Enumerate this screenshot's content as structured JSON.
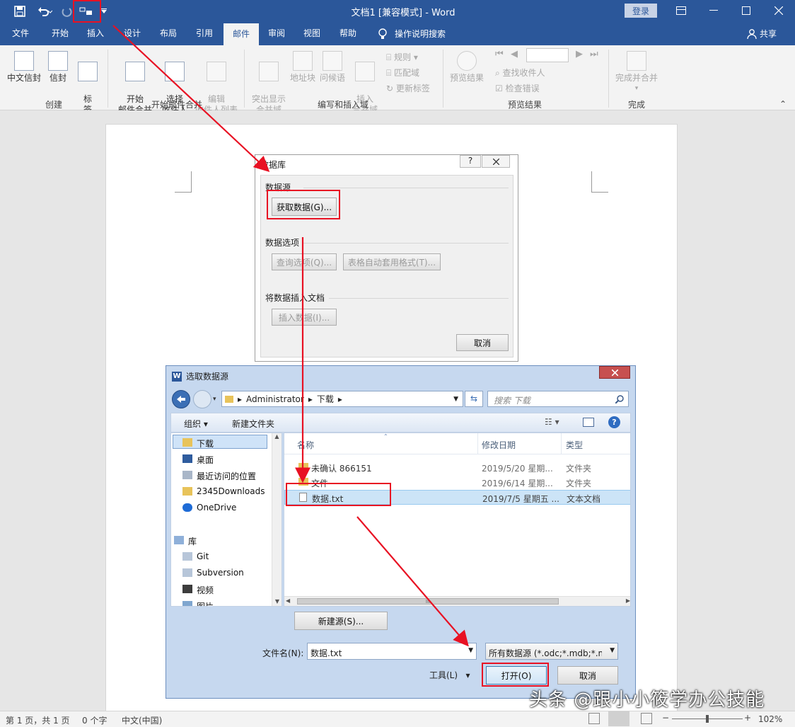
{
  "window": {
    "title": "文档1 [兼容模式] - Word",
    "login_label": "登录",
    "colors": {
      "brand": "#2b579a",
      "annotation": "#e81123"
    }
  },
  "quick_access": {
    "save_icon": "save-icon",
    "undo_icon": "undo-icon",
    "redo_icon": "redo-icon",
    "mailmerge_icon": "database-icon",
    "customize_icon": "dropdown-icon"
  },
  "tabs": [
    {
      "label": "文件"
    },
    {
      "label": "开始"
    },
    {
      "label": "插入"
    },
    {
      "label": "设计"
    },
    {
      "label": "布局"
    },
    {
      "label": "引用"
    },
    {
      "label": "邮件",
      "active": true
    },
    {
      "label": "审阅"
    },
    {
      "label": "视图"
    },
    {
      "label": "帮助"
    }
  ],
  "tell_me": "操作说明搜索",
  "share": "共享",
  "ribbon": {
    "create": {
      "envelope": "中文信封",
      "envelopes": "信封",
      "labels": "标\n签",
      "group": "创建"
    },
    "start": {
      "start_merge": "开始\n邮件合并",
      "select_recipients": "选择\n收件人",
      "edit_list": "编辑\n收件人列表",
      "group": "开始邮件合并"
    },
    "write": {
      "highlight": "突出显示\n合并域",
      "address_block": "地址块",
      "greeting": "问候语",
      "insert_field": "插入\n合并域",
      "rules": "规则",
      "match_fields": "匹配域",
      "update_labels": "更新标签",
      "group": "编写和插入域"
    },
    "preview": {
      "preview_results": "预览结果",
      "find_recipient": "查找收件人",
      "check_errors": "检查错误",
      "group": "预览结果"
    },
    "finish": {
      "finish_merge": "完成并合并",
      "group": "完成"
    }
  },
  "db_dialog": {
    "title": "数据库",
    "help": "?",
    "section_source": "数据源",
    "get_data": "获取数据(G)...",
    "section_options": "数据选项",
    "query_options": "查询选项(Q)...",
    "table_autoformat": "表格自动套用格式(T)...",
    "section_insert": "将数据插入文档",
    "insert_data": "插入数据(I)...",
    "cancel": "取消"
  },
  "file_dialog": {
    "title": "选取数据源",
    "breadcrumb": [
      "Administrator",
      "下载"
    ],
    "search_placeholder": "搜索 下载",
    "organize": "组织",
    "new_folder": "新建文件夹",
    "nav": [
      {
        "label": "下载",
        "icon": "downloads-folder-icon",
        "selected": true
      },
      {
        "label": "桌面",
        "icon": "desktop-icon"
      },
      {
        "label": "最近访问的位置",
        "icon": "recent-places-icon"
      },
      {
        "label": "2345Downloads",
        "icon": "folder-icon"
      },
      {
        "label": "OneDrive",
        "icon": "onedrive-icon"
      },
      {
        "label": "库",
        "icon": "library-icon"
      },
      {
        "label": "Git",
        "icon": "library-folder-icon"
      },
      {
        "label": "Subversion",
        "icon": "library-folder-icon"
      },
      {
        "label": "视频",
        "icon": "video-icon"
      },
      {
        "label": "图片",
        "icon": "pictures-icon"
      }
    ],
    "columns": [
      "名称",
      "修改日期",
      "类型"
    ],
    "files": [
      {
        "name": "未确认 866151",
        "date": "2019/5/20 星期...",
        "type": "文件夹",
        "icon": "folder-icon"
      },
      {
        "name": "文件",
        "date": "2019/6/14 星期...",
        "type": "文件夹",
        "icon": "folder-icon"
      },
      {
        "name": "数据.txt",
        "date": "2019/7/5 星期五 ...",
        "type": "文本文档",
        "icon": "text-file-icon",
        "selected": true
      }
    ],
    "new_source": "新建源(S)...",
    "filename_label": "文件名(N):",
    "filename_value": "数据.txt",
    "filetype": "所有数据源 (*.odc;*.mdb;*.mdb",
    "tools": "工具(L)",
    "open": "打开(O)",
    "cancel": "取消",
    "scroll_marker": "III"
  },
  "status": {
    "page": "第 1 页，共 1 页",
    "words": "0 个字",
    "lang": "中文(中国)",
    "zoom": "102%",
    "zoom_minus": "−",
    "zoom_plus": "+"
  },
  "watermark": "头条 @跟小小筱学办公技能"
}
